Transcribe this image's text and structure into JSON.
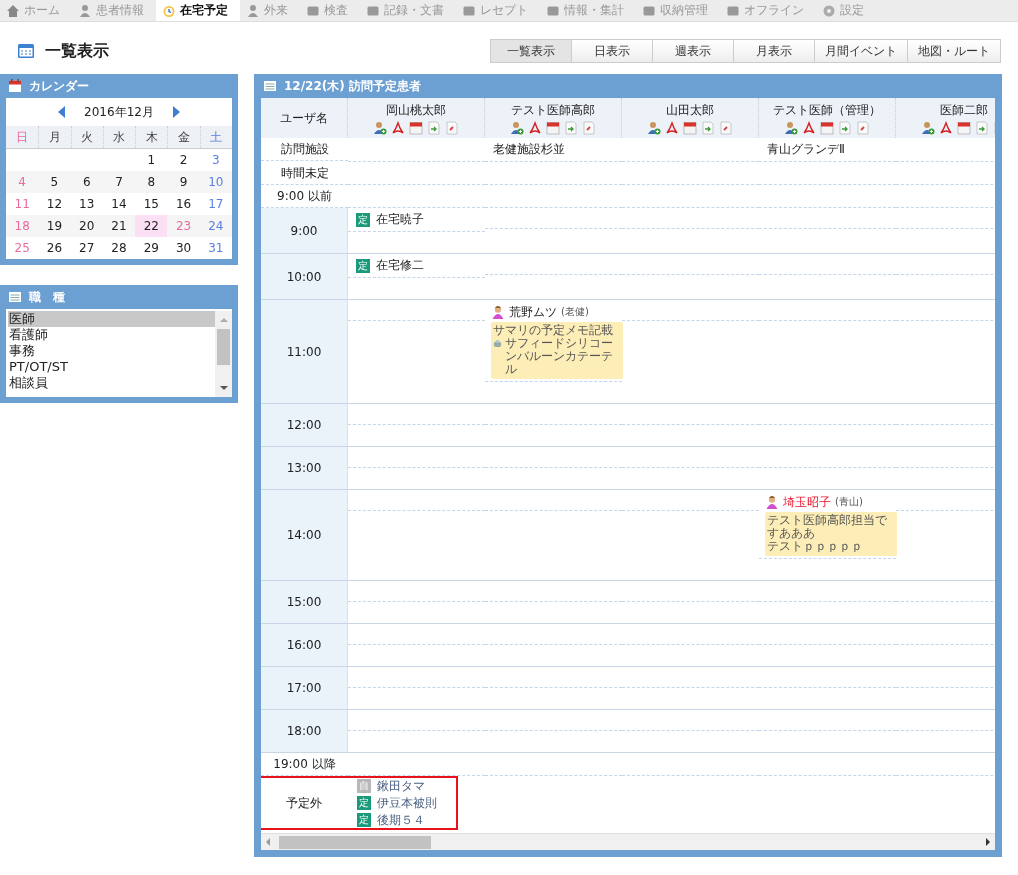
{
  "nav": {
    "tabs": [
      {
        "label": "ホーム",
        "selected": false
      },
      {
        "label": "患者情報",
        "selected": false
      },
      {
        "label": "在宅予定",
        "selected": true
      },
      {
        "label": "外来",
        "selected": false
      },
      {
        "label": "検査",
        "selected": false
      },
      {
        "label": "記録・文書",
        "selected": false
      },
      {
        "label": "レセプト",
        "selected": false
      },
      {
        "label": "情報・集計",
        "selected": false
      },
      {
        "label": "収納管理",
        "selected": false
      },
      {
        "label": "オフライン",
        "selected": false
      },
      {
        "label": "設定",
        "selected": false
      }
    ]
  },
  "page_title": "一覧表示",
  "view_buttons": [
    {
      "label": "一覧表示",
      "selected": true
    },
    {
      "label": "日表示",
      "selected": false
    },
    {
      "label": "週表示",
      "selected": false
    },
    {
      "label": "月表示",
      "selected": false
    },
    {
      "label": "月間イベント",
      "selected": false
    },
    {
      "label": "地図・ルート",
      "selected": false
    }
  ],
  "calendar": {
    "title": "カレンダー",
    "month": "2016年12月",
    "weekdays": [
      {
        "label": "日",
        "kind": "sun"
      },
      {
        "label": "月",
        "kind": "week"
      },
      {
        "label": "火",
        "kind": "week"
      },
      {
        "label": "水",
        "kind": "week"
      },
      {
        "label": "木",
        "kind": "week"
      },
      {
        "label": "金",
        "kind": "week"
      },
      {
        "label": "土",
        "kind": "sat"
      }
    ],
    "weeks": [
      [
        {
          "day": "1",
          "kind": "week",
          "selected": false
        },
        {
          "day": "2",
          "kind": "week",
          "selected": false
        },
        {
          "day": "3",
          "kind": "sat",
          "selected": false
        }
      ],
      [
        {
          "day": "4",
          "kind": "sun",
          "selected": false
        },
        {
          "day": "5",
          "kind": "week",
          "selected": false
        },
        {
          "day": "6",
          "kind": "week",
          "selected": false
        },
        {
          "day": "7",
          "kind": "week",
          "selected": false
        },
        {
          "day": "8",
          "kind": "week",
          "selected": false
        },
        {
          "day": "9",
          "kind": "week",
          "selected": false
        },
        {
          "day": "10",
          "kind": "sat",
          "selected": false
        }
      ],
      [
        {
          "day": "11",
          "kind": "sun",
          "selected": false
        },
        {
          "day": "12",
          "kind": "week",
          "selected": false
        },
        {
          "day": "13",
          "kind": "week",
          "selected": false
        },
        {
          "day": "14",
          "kind": "week",
          "selected": false
        },
        {
          "day": "15",
          "kind": "week",
          "selected": false
        },
        {
          "day": "16",
          "kind": "week",
          "selected": false
        },
        {
          "day": "17",
          "kind": "sat",
          "selected": false
        }
      ],
      [
        {
          "day": "18",
          "kind": "sun",
          "selected": false
        },
        {
          "day": "19",
          "kind": "week",
          "selected": false
        },
        {
          "day": "20",
          "kind": "week",
          "selected": false
        },
        {
          "day": "21",
          "kind": "week",
          "selected": false
        },
        {
          "day": "22",
          "kind": "week",
          "selected": true
        },
        {
          "day": "23",
          "kind": "holiday",
          "selected": false
        },
        {
          "day": "24",
          "kind": "sat",
          "selected": false
        }
      ],
      [
        {
          "day": "25",
          "kind": "sun",
          "selected": false
        },
        {
          "day": "26",
          "kind": "week",
          "selected": false
        },
        {
          "day": "27",
          "kind": "week",
          "selected": false
        },
        {
          "day": "28",
          "kind": "week",
          "selected": false
        },
        {
          "day": "29",
          "kind": "week",
          "selected": false
        },
        {
          "day": "30",
          "kind": "week",
          "selected": false
        },
        {
          "day": "31",
          "kind": "sat",
          "selected": false
        }
      ]
    ]
  },
  "job_types": {
    "title": "職　種",
    "items": [
      {
        "label": "医師",
        "selected": true
      },
      {
        "label": "看護師",
        "selected": false
      },
      {
        "label": "事務",
        "selected": false
      },
      {
        "label": "PT/OT/ST",
        "selected": false
      },
      {
        "label": "相談員",
        "selected": false
      }
    ]
  },
  "schedule": {
    "title": "12/22(木) 訪問予定患者",
    "corner_label": "ユーザ名",
    "doctors": [
      {
        "name": "岡山桃太郎"
      },
      {
        "name": "テスト医師高郎"
      },
      {
        "name": "山田太郎"
      },
      {
        "name": "テスト医師（管理）"
      },
      {
        "name": "医師二郎"
      }
    ],
    "rows": [
      {
        "label": "訪問施設",
        "kind": "plain",
        "cells": [
          [],
          [
            {
              "kind": "facility",
              "name": "老健施設杉並"
            }
          ],
          [],
          [
            {
              "kind": "facility",
              "name": "青山グランデⅡ"
            }
          ],
          []
        ]
      },
      {
        "label": "時間未定",
        "kind": "plain"
      },
      {
        "label": "9:00 以前",
        "kind": "plain"
      },
      {
        "label": "9:00",
        "kind": "hour",
        "cells": [
          [
            {
              "kind": "appointment",
              "badge": "定",
              "name": "在宅暁子"
            }
          ],
          [],
          [],
          [],
          []
        ]
      },
      {
        "label": "10:00",
        "kind": "hour",
        "cells": [
          [
            {
              "kind": "appointment",
              "badge": "定",
              "name": "在宅修二"
            }
          ],
          [],
          [],
          [],
          []
        ]
      },
      {
        "label": "11:00",
        "kind": "hour",
        "cells": [
          [],
          [
            {
              "kind": "patient",
              "name": "荒野ムツ",
              "alert": false,
              "tag": "(老健)",
              "memo": [
                {
                  "text": "サマリの予定メモ記載",
                  "icon": false
                },
                {
                  "text": "サフィードシリコーンバルーンカテーテル",
                  "icon": true
                }
              ]
            }
          ],
          [],
          [],
          []
        ]
      },
      {
        "label": "12:00",
        "kind": "hour"
      },
      {
        "label": "13:00",
        "kind": "hour"
      },
      {
        "label": "14:00",
        "kind": "hour",
        "cells": [
          [],
          [],
          [],
          [
            {
              "kind": "patient",
              "name": "埼玉昭子",
              "alert": true,
              "tag": "(青山)",
              "memo": [
                {
                  "text": "テスト医師高郎担当ですあああ",
                  "icon": false
                },
                {
                  "text": "テストｐｐｐｐｐ",
                  "icon": false
                }
              ]
            }
          ],
          []
        ]
      },
      {
        "label": "15:00",
        "kind": "hour"
      },
      {
        "label": "16:00",
        "kind": "hour"
      },
      {
        "label": "17:00",
        "kind": "hour"
      },
      {
        "label": "18:00",
        "kind": "hour"
      },
      {
        "label": "19:00 以降",
        "kind": "plain"
      }
    ],
    "unscheduled": {
      "label": "予定外",
      "highlighted": true,
      "items": [
        {
          "badge": "自",
          "kind": "self",
          "name": "鍬田タマ"
        },
        {
          "badge": "定",
          "kind": "regular",
          "name": "伊豆本被則"
        },
        {
          "badge": "定",
          "kind": "regular",
          "name": "後期５４"
        }
      ]
    }
  }
}
